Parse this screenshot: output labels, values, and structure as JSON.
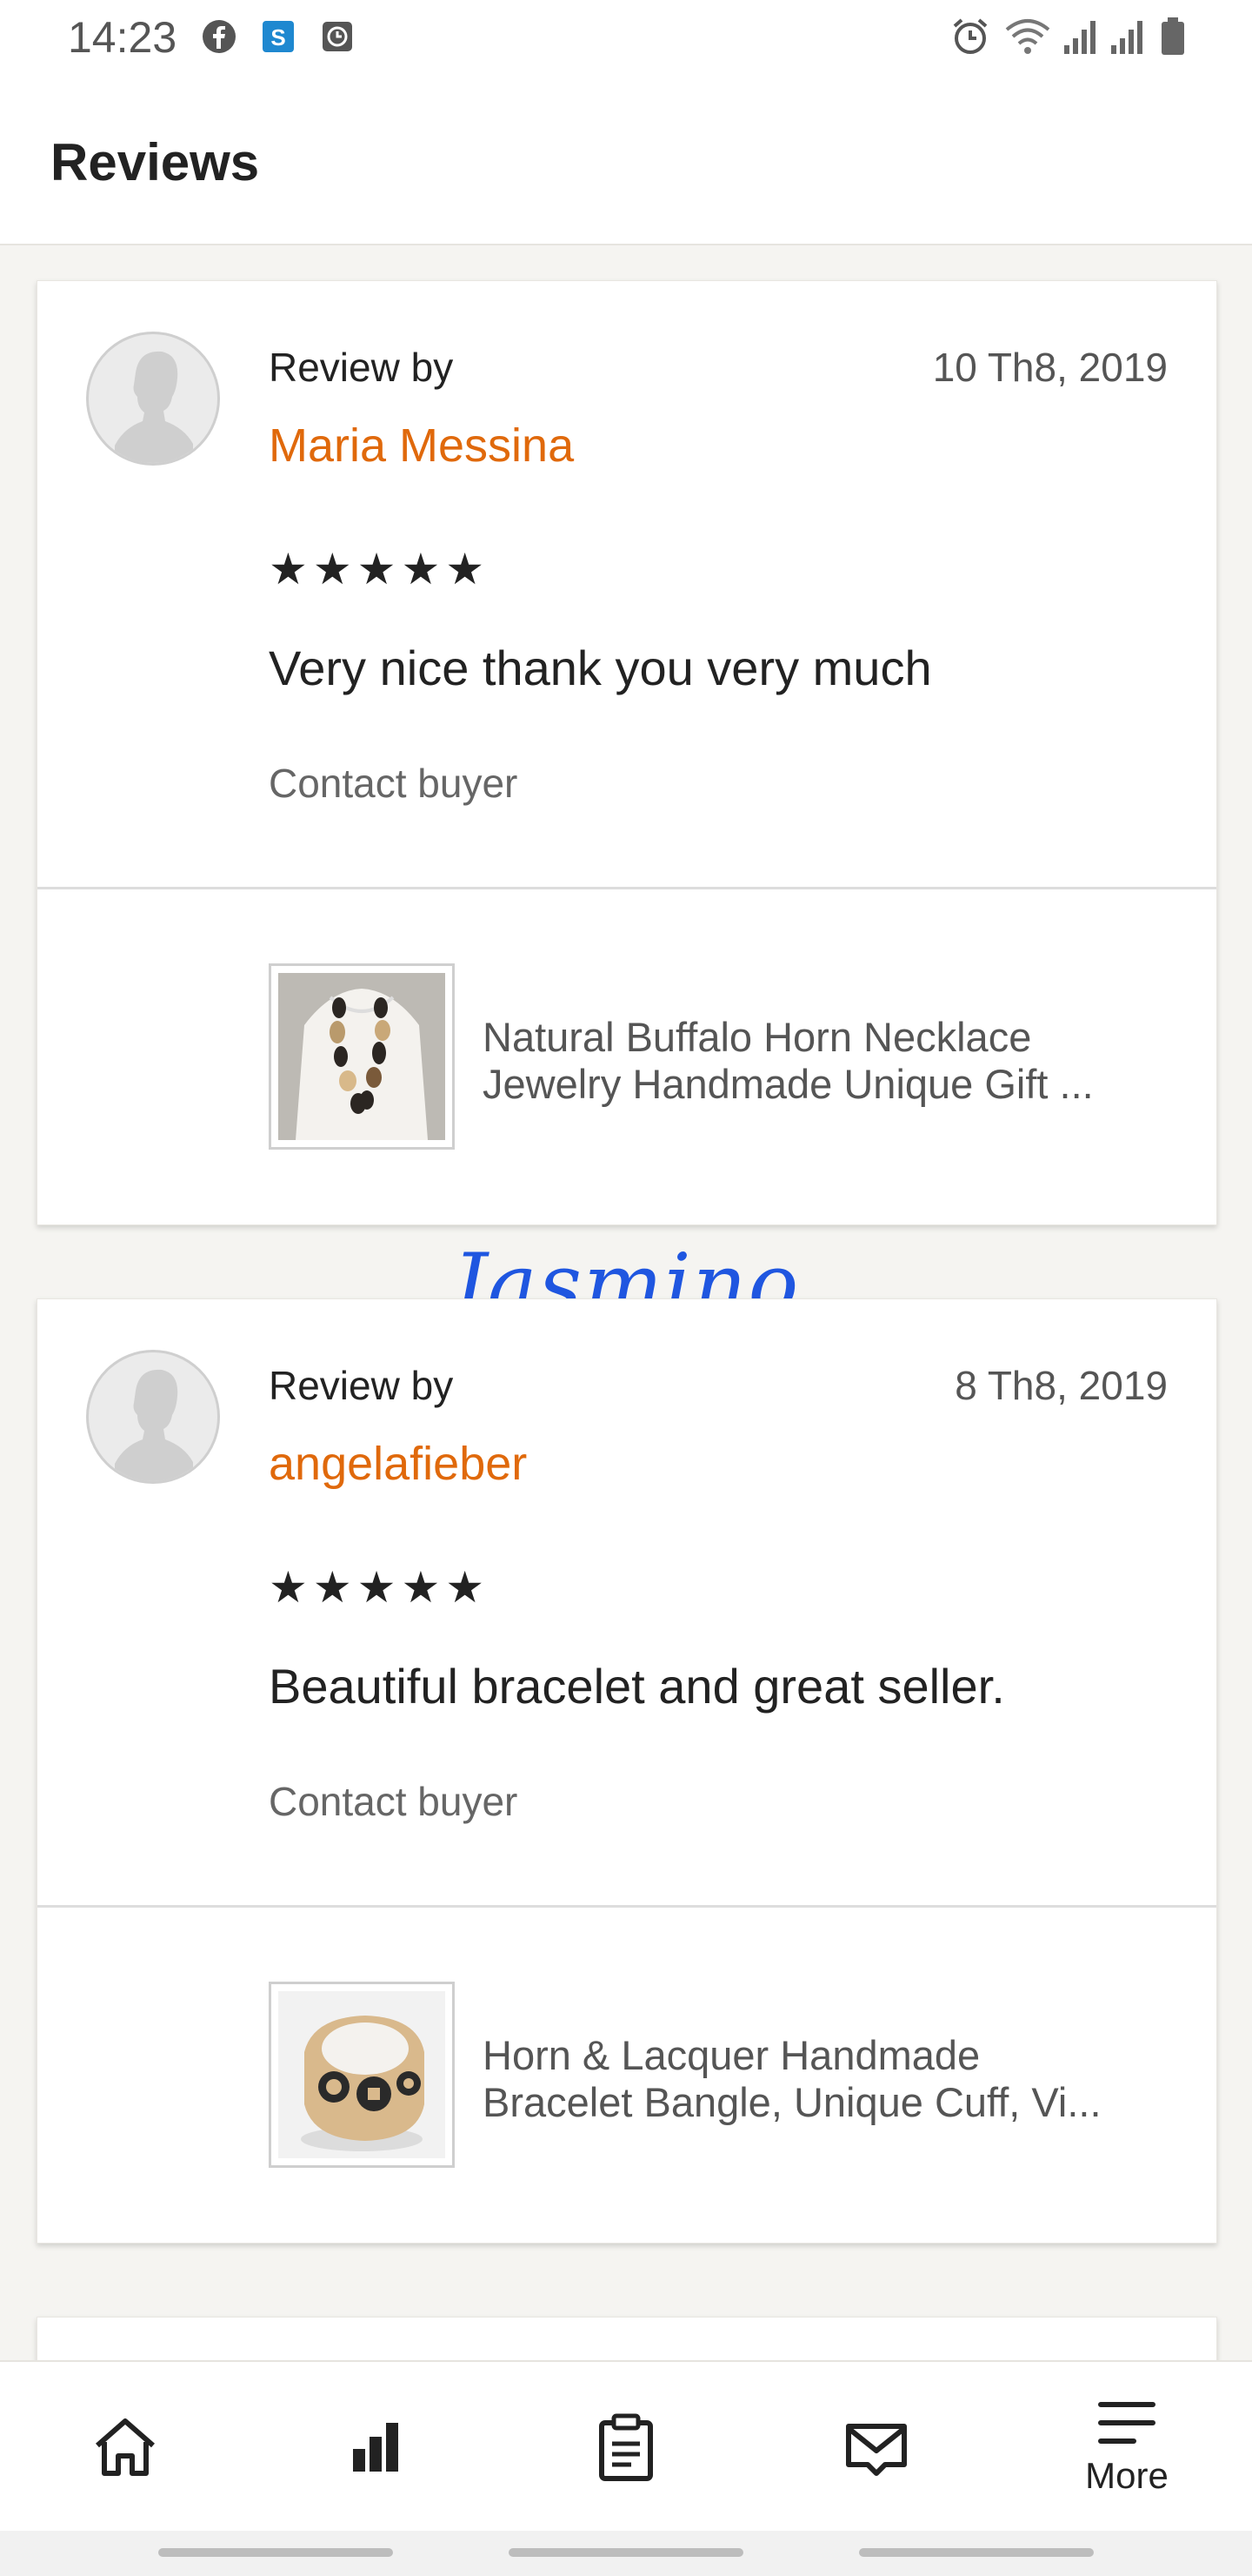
{
  "status": {
    "time": "14:23",
    "app_icons": [
      "facebook-icon",
      "skype-icon",
      "clock-app-icon"
    ],
    "right_icons": [
      "alarm-icon",
      "wifi-icon",
      "signal-icon",
      "signal-icon",
      "battery-icon"
    ]
  },
  "header": {
    "title": "Reviews"
  },
  "reviews": [
    {
      "label": "Review by",
      "reviewer": "Maria Messina",
      "date": "10 Th8, 2019",
      "stars": "★★★★★",
      "rating": 5,
      "text": "Very nice thank you very much",
      "contact": "Contact buyer",
      "product_line1": "Natural Buffalo Horn Necklace",
      "product_line2": "Jewelry Handmade Unique Gift ..."
    },
    {
      "label": "Review by",
      "reviewer": "angelafieber",
      "date": "8 Th8, 2019",
      "stars": "★★★★★",
      "rating": 5,
      "text": "Beautiful bracelet and great seller.",
      "contact": "Contact buyer",
      "product_line1": "Horn & Lacquer Handmade",
      "product_line2": "Bracelet Bangle, Unique Cuff, Vi..."
    }
  ],
  "watermark": "Jasmino",
  "colors": {
    "accent": "#e0690b",
    "watermark": "#1f56e0"
  },
  "nav": {
    "items": [
      {
        "icon": "home-icon"
      },
      {
        "icon": "stats-icon"
      },
      {
        "icon": "orders-icon"
      },
      {
        "icon": "messages-icon"
      },
      {
        "icon": "menu-icon",
        "label": "More"
      }
    ]
  }
}
